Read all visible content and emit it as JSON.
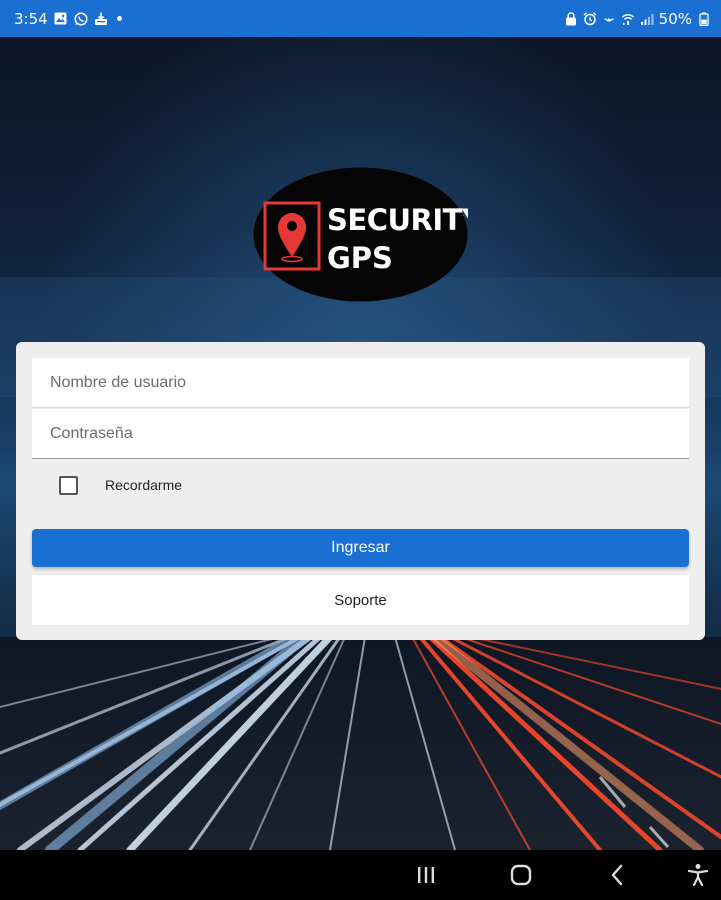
{
  "status_bar": {
    "time": "3:54",
    "battery": "50%",
    "left_icons": [
      "gallery-icon",
      "whatsapp-icon",
      "download-icon"
    ],
    "right_icons": [
      "lock-icon",
      "alarm-icon",
      "hotspot-icon",
      "wifi-calling-icon",
      "signal-icon",
      "battery-icon"
    ],
    "color": "#1a6fd3"
  },
  "logo": {
    "text_line1": "SECURITY",
    "text_line2": "GPS",
    "accent": "#e53935"
  },
  "login": {
    "username_placeholder": "Nombre de usuario",
    "password_placeholder": "Contraseña",
    "remember_label": "Recordarme",
    "remember_checked": false,
    "submit_label": "Ingresar",
    "support_label": "Soporte",
    "accent": "#1a6fd3"
  },
  "nav_bar": {
    "icons": [
      "recents-icon",
      "home-icon",
      "back-icon",
      "accessibility-icon"
    ]
  }
}
